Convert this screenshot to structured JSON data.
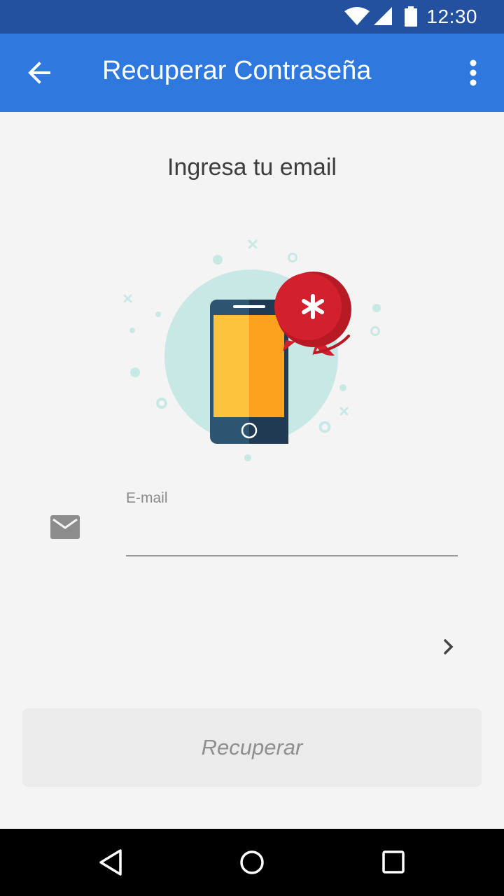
{
  "status_bar": {
    "time": "12:30",
    "icons": [
      "wifi-icon",
      "signal-icon",
      "battery-icon"
    ]
  },
  "app_bar": {
    "title": "Recuperar Contraseña",
    "back_icon": "arrow-back-icon",
    "menu_icon": "more-vert-icon",
    "color": "#2f78dd"
  },
  "main": {
    "heading": "Ingresa tu email",
    "illustration": "phone-password-illustration",
    "email_field": {
      "label": "E-mail",
      "value": "",
      "icon": "mail-icon"
    },
    "next_icon": "chevron-right-icon",
    "recover_button_label": "Recuperar"
  },
  "nav_bar": {
    "icons": [
      "nav-back-icon",
      "nav-home-icon",
      "nav-recents-icon"
    ]
  },
  "colors": {
    "status_bar": "#2450a0",
    "primary": "#2f78dd",
    "accent_red": "#d2202f",
    "background": "#f4f4f4"
  }
}
